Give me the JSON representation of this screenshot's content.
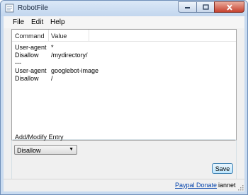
{
  "window": {
    "title": "RobotFile"
  },
  "menu": {
    "items": [
      "File",
      "Edit",
      "Help"
    ]
  },
  "list": {
    "columns": [
      "Command",
      "Value"
    ],
    "rows": [
      {
        "command": "User-agent",
        "value": "*"
      },
      {
        "command": "Disallow",
        "value": "/mydirectory/"
      },
      {
        "command": "---",
        "value": ""
      },
      {
        "command": "User-agent",
        "value": "googlebot-image"
      },
      {
        "command": "Disallow",
        "value": "/"
      }
    ]
  },
  "entry": {
    "group_label": "Add/Modify Entry",
    "selected": "Disallow",
    "save_label": "Save"
  },
  "status": {
    "donate_label": "Paypal Donate",
    "author": "iannet"
  }
}
